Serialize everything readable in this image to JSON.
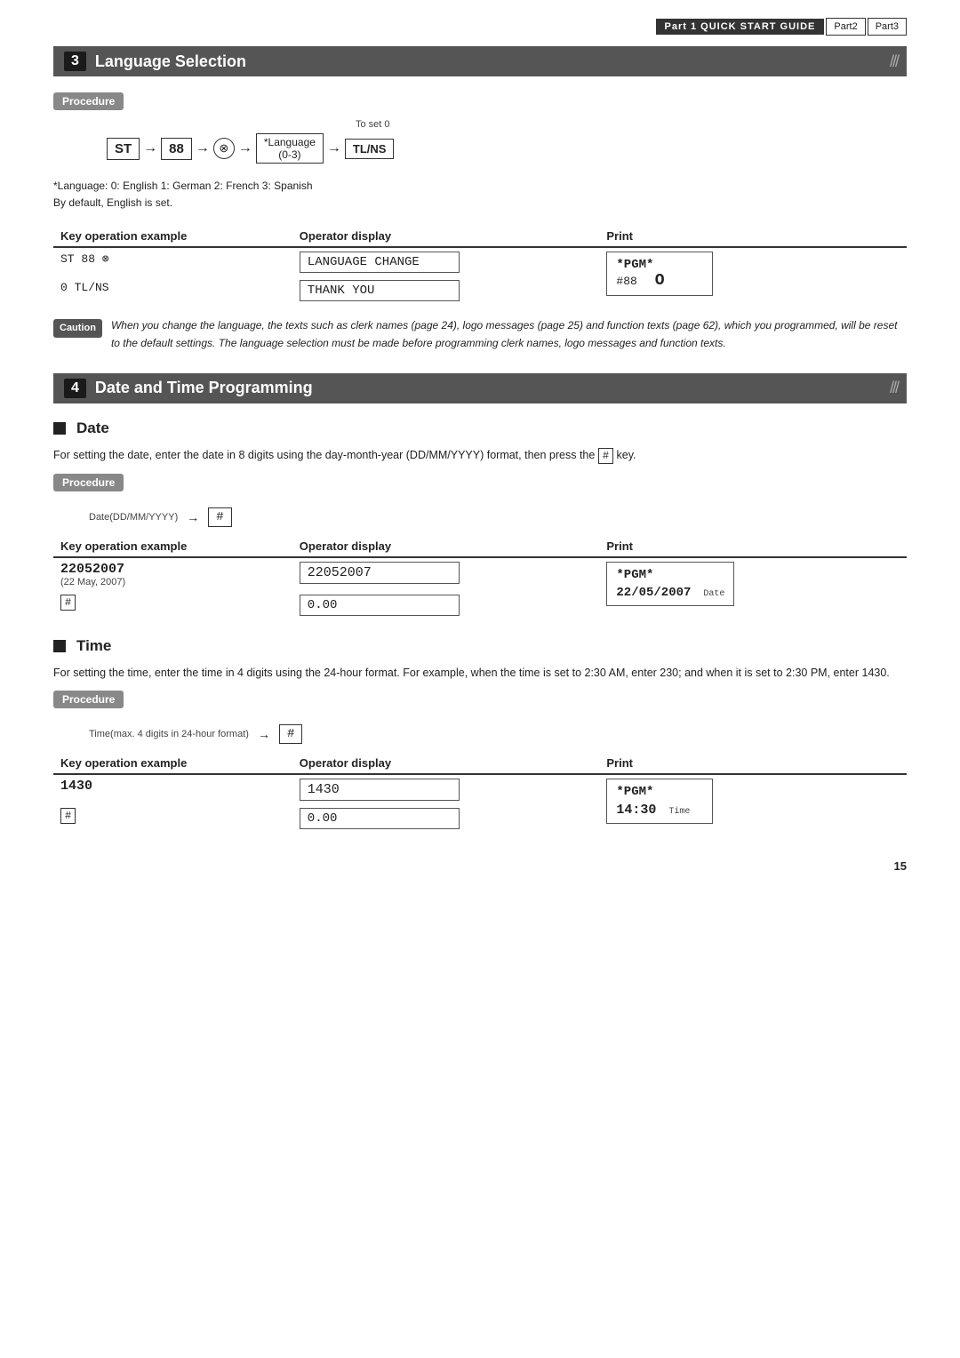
{
  "header": {
    "part1": "Part 1",
    "quick_start": "QUICK START GUIDE",
    "part2": "Part2",
    "part3": "Part3"
  },
  "section3": {
    "number": "3",
    "title": "Language Selection",
    "procedure_label": "Procedure",
    "to_set": "To set 0",
    "st_key": "ST",
    "num88": "88",
    "lang_label": "*Language\n(0-3)",
    "tlns": "TL/NS",
    "lang_note1": "*Language: 0: English    1: German    2: French    3: Spanish",
    "lang_note2": "By default, English is set.",
    "table": {
      "col1": "Key operation example",
      "col2": "Operator display",
      "col3": "Print",
      "row1_key": "ST 88 ⊗",
      "row1_disp": "LANGUAGE CHANGE",
      "row1_print_line1": "*PGM*",
      "row1_print_line2": "#88",
      "row1_print_o": "O",
      "row2_key": "0 TL/NS",
      "row2_disp": "THANK YOU"
    },
    "caution_label": "Caution",
    "caution_text": "When you change the language, the texts such as clerk names (page 24), logo messages (page 25) and function texts (page 62), which you programmed, will be reset to the default settings. The language selection must be made before programming clerk names, logo messages and function texts."
  },
  "section4": {
    "number": "4",
    "title": "Date and Time Programming",
    "date_section": {
      "title": "Date",
      "body1": "For setting the date, enter the date in 8 digits using the day-month-year (DD/MM/YYYY) format, then press the",
      "body1_key": "#",
      "body1_end": "key.",
      "procedure_label": "Procedure",
      "diag_label": "Date(DD/MM/YYYY)",
      "diag_key": "#",
      "table": {
        "col1": "Key operation example",
        "col2": "Operator display",
        "col3": "Print",
        "row1_key": "22052007",
        "row1_sub": "(22 May, 2007)",
        "row1_disp": "22052007",
        "row1_print_pgm": "*PGM*",
        "row2_key": "#",
        "row2_disp": "0.00",
        "row2_print_date": "22/05/2007",
        "row2_print_label": "Date"
      }
    },
    "time_section": {
      "title": "Time",
      "body1": "For setting the time, enter the time in 4 digits using the 24-hour format.  For example, when the time is set to 2:30 AM, enter 230; and when it is set to 2:30 PM, enter 1430.",
      "procedure_label": "Procedure",
      "diag_label": "Time(max. 4 digits in 24-hour format)",
      "diag_key": "#",
      "table": {
        "col1": "Key operation example",
        "col2": "Operator display",
        "col3": "Print",
        "row1_key": "1430",
        "row1_disp": "1430",
        "row1_print_pgm": "*PGM*",
        "row2_key": "#",
        "row2_disp": "0.00",
        "row2_print_time": "14:30",
        "row2_print_label": "Time"
      }
    }
  },
  "page_number": "15"
}
